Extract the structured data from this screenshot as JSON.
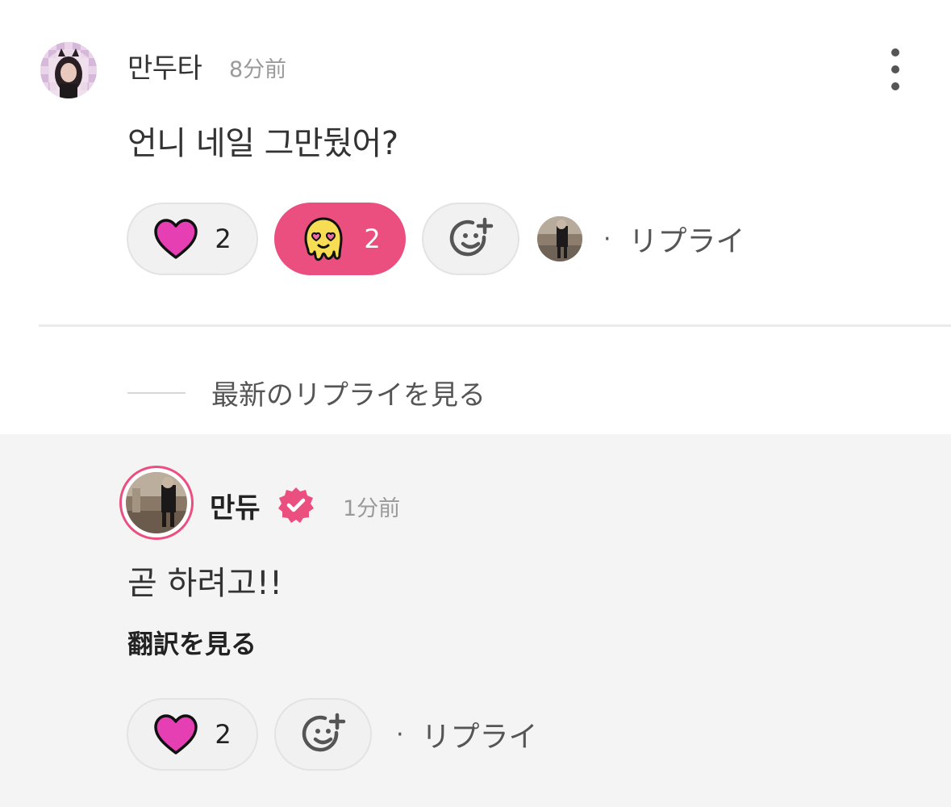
{
  "colors": {
    "accent_pink": "#ea4f7f",
    "heart_magenta": "#e63fb4",
    "text_primary": "#333333",
    "text_muted": "#9a9a9a",
    "reply_bg": "#f4f4f4"
  },
  "comment": {
    "username": "만두타",
    "time": "8分前",
    "body": "언니 네일 그만뒀어?",
    "reactions": [
      {
        "icon": "heart-icon",
        "count": "2",
        "selected": false
      },
      {
        "icon": "melting-heart-eyes-emoji-icon",
        "count": "2",
        "selected": true
      }
    ],
    "reply_label": "リプライ",
    "separator": "·"
  },
  "view_latest": {
    "label": "最新のリプライを見る"
  },
  "reply": {
    "username": "만듀",
    "verified": true,
    "time": "1分前",
    "body": "곧 하려고!!",
    "translate_label": "翻訳を見る",
    "reactions": [
      {
        "icon": "heart-icon",
        "count": "2",
        "selected": false
      }
    ],
    "reply_label": "リプライ",
    "separator": "·"
  }
}
